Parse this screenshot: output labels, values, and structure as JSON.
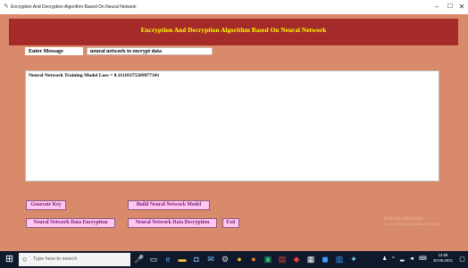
{
  "window": {
    "title": "Encryption And Decryption Algorithm Based On Neural Network",
    "minimize": "–",
    "maximize": "☐",
    "close": "✕"
  },
  "app": {
    "header_title": "Encryption And Decryption Algorithm Based On Neural Network",
    "enter_message_label": "Enter Message",
    "message_value": "neural network to encrypt data",
    "output_text": "Neural Network Training Model Loss = 0.11118375509977341",
    "buttons": {
      "generate_key": "Generate Key",
      "build_model": "Build Neural Network Model",
      "encryption": "Neural Network Data Encryption",
      "decryption": "Neural Network Data Decryption",
      "exit": "Exit"
    }
  },
  "watermark": {
    "line1": "Activate Windows",
    "line2": "Go to Settings to activate Windows."
  },
  "taskbar": {
    "search_placeholder": "Type here to search",
    "clock_time": "14:08",
    "clock_date": "30-06-2021",
    "icons": [
      "windows-start-icon",
      "search-icon",
      "mic-icon",
      "task-view-icon",
      "edge-icon",
      "file-explorer-icon",
      "store-icon",
      "mail-icon",
      "settings-icon",
      "chrome-icon",
      "firefox-icon",
      "terminal-icon",
      "pdf-icon",
      "python-icon",
      "network-icon",
      "vscode-icon",
      "photos-icon",
      "bluetooth-icon",
      "notification-icon"
    ],
    "colors": {
      "taskbar_bg": "#0e1a2b",
      "header_bg": "#a52a2a",
      "header_text": "#ffff00",
      "app_bg": "#d98a6a",
      "button_bg": "#ffc7f0",
      "button_text": "#7a1a78"
    }
  }
}
